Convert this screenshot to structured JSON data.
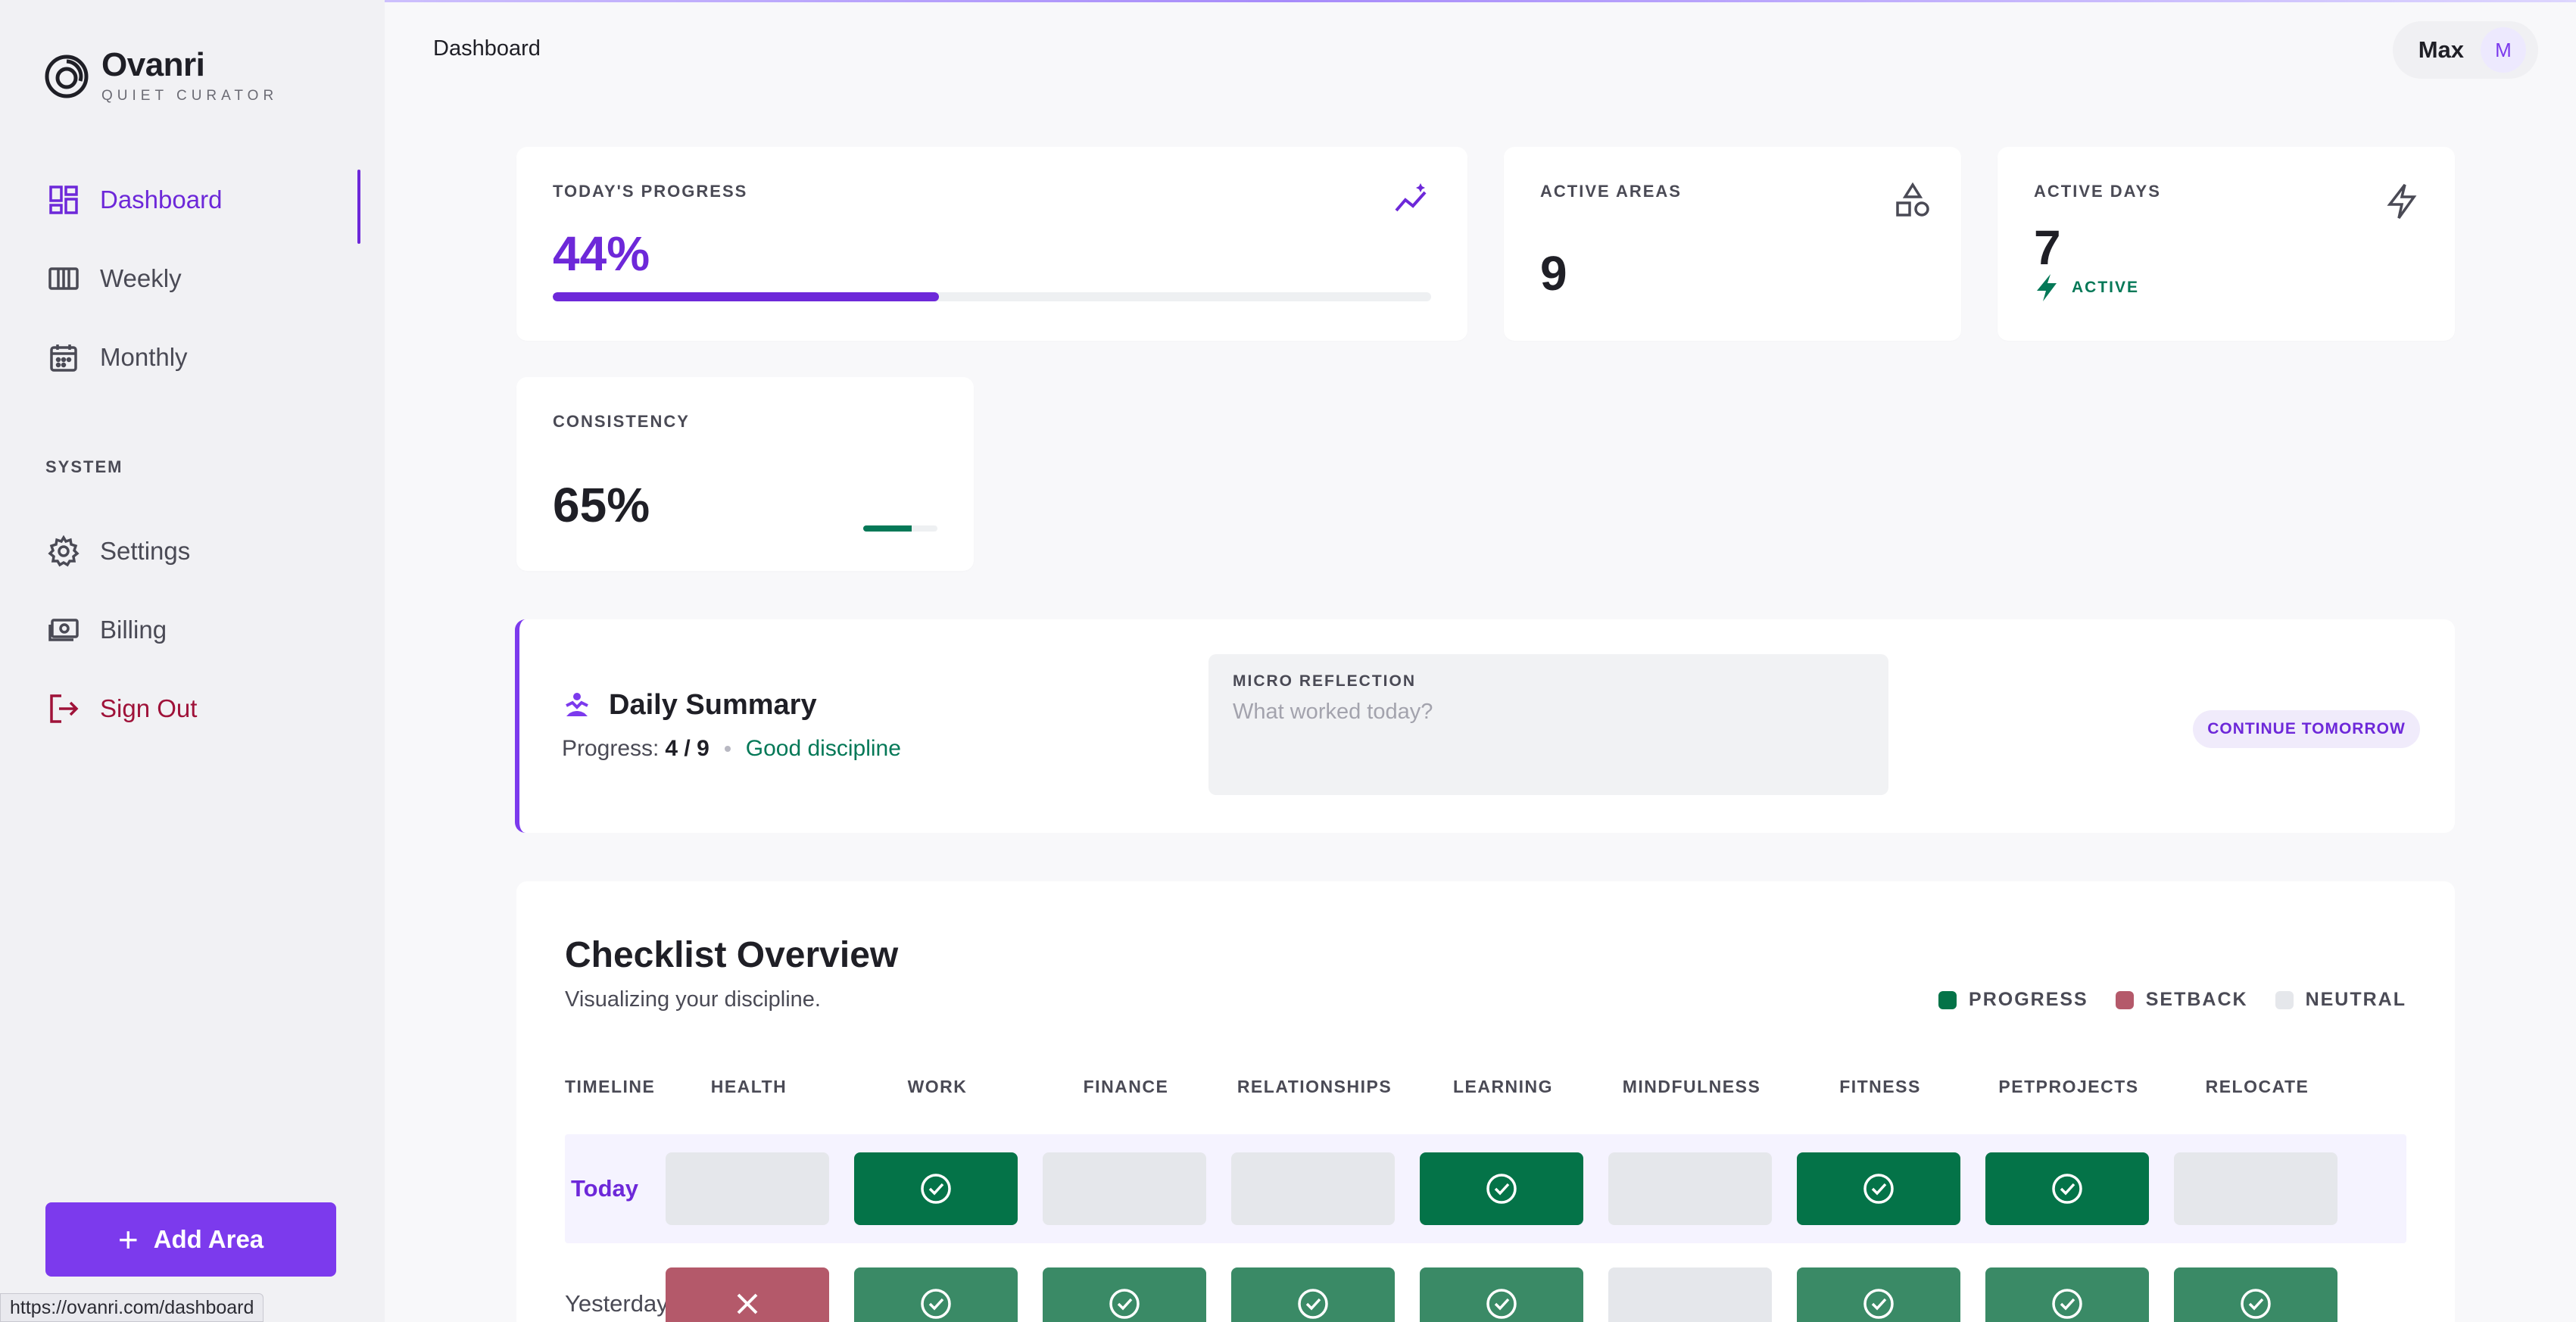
{
  "brand": {
    "name": "Ovanri",
    "tagline": "QUIET CURATOR"
  },
  "nav": {
    "dashboard": "Dashboard",
    "weekly": "Weekly",
    "monthly": "Monthly",
    "system_label": "SYSTEM",
    "settings": "Settings",
    "billing": "Billing",
    "signout": "Sign Out"
  },
  "add_area_label": "Add Area",
  "status_url": "https://ovanri.com/dashboard",
  "header": {
    "title": "Dashboard",
    "user_name": "Max",
    "avatar_initial": "M"
  },
  "stats": {
    "progress": {
      "label": "TODAY'S PROGRESS",
      "value": "44%",
      "fraction": 0.44
    },
    "areas": {
      "label": "ACTIVE AREAS",
      "value": "9"
    },
    "days": {
      "label": "ACTIVE DAYS",
      "value": "7",
      "badge": "ACTIVE"
    },
    "consistency": {
      "label": "CONSISTENCY",
      "value": "65%",
      "fraction": 0.65
    }
  },
  "summary": {
    "title": "Daily Summary",
    "progress_label": "Progress:",
    "progress_value": "4 / 9",
    "status": "Good discipline",
    "reflection_label": "MICRO REFLECTION",
    "reflection_placeholder": "What worked today?",
    "continue_label": "CONTINUE TOMORROW"
  },
  "checklist": {
    "title": "Checklist Overview",
    "subtitle": "Visualizing your discipline.",
    "legend": {
      "progress": "PROGRESS",
      "setback": "SETBACK",
      "neutral": "NEUTRAL"
    },
    "timeline_label": "TIMELINE",
    "columns": [
      "HEALTH",
      "WORK",
      "FINANCE",
      "RELATIONSHIPS",
      "LEARNING",
      "MINDFULNESS",
      "FITNESS",
      "PETPROJECTS",
      "RELOCATE"
    ],
    "rows": [
      {
        "label": "Today",
        "cells": [
          "neutral",
          "progress",
          "neutral",
          "neutral",
          "progress",
          "neutral",
          "progress",
          "progress",
          "neutral"
        ]
      },
      {
        "label": "Yesterday",
        "cells": [
          "setback",
          "progress",
          "progress",
          "progress",
          "progress",
          "neutral",
          "progress",
          "progress",
          "progress"
        ]
      }
    ]
  },
  "colors": {
    "accent": "#6d28d9",
    "progress": "#047348",
    "setback": "#b4596a",
    "neutral": "#e5e7eb"
  }
}
